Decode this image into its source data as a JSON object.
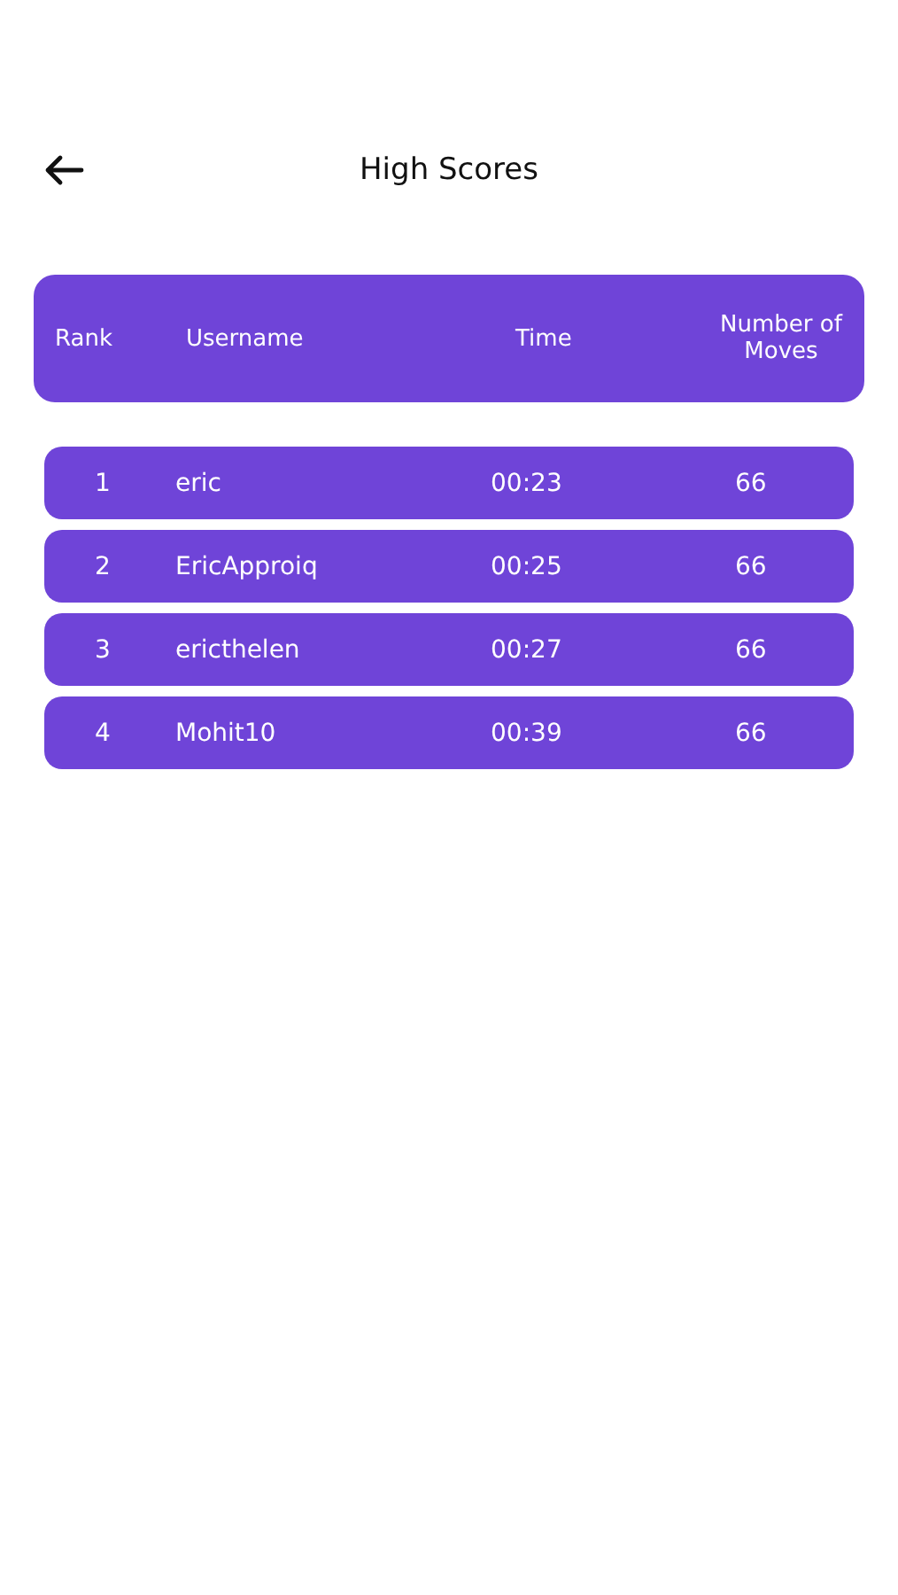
{
  "header": {
    "title": "High Scores"
  },
  "table": {
    "columns": [
      "Rank",
      "Username",
      "Time",
      "Number of Moves"
    ],
    "rows": [
      {
        "rank": "1",
        "username": "eric",
        "time": "00:23",
        "moves": "66"
      },
      {
        "rank": "2",
        "username": "EricApproiq",
        "time": "00:25",
        "moves": "66"
      },
      {
        "rank": "3",
        "username": "ericthelen",
        "time": "00:27",
        "moves": "66"
      },
      {
        "rank": "4",
        "username": "Mohit10",
        "time": "00:39",
        "moves": "66"
      }
    ]
  }
}
